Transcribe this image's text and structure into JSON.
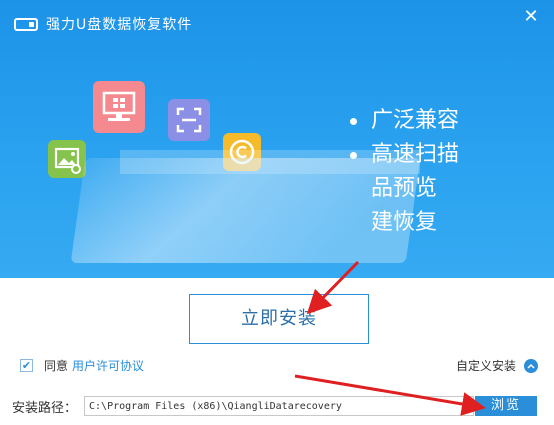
{
  "window": {
    "title": "强力U盘数据恢复软件",
    "close_glyph": "✕"
  },
  "hero": {
    "features": [
      "广泛兼容",
      "高速扫描",
      "品预览",
      "建恢复"
    ]
  },
  "actions": {
    "install_label": "立即安装",
    "browse_label": "浏览"
  },
  "agreement": {
    "checked": true,
    "check_glyph": "✔",
    "prefix": "同意",
    "link_text": "用户许可协议"
  },
  "custom_install": {
    "label": "自定义安装",
    "icon": "chevron-up-icon"
  },
  "install_path": {
    "label": "安装路径：",
    "value": "C:\\Program Files (x86)\\QiangliDatarecovery"
  },
  "colors": {
    "hero_blue": "#2aa2ef",
    "accent": "#2a8ed8",
    "arrow_red": "#e02020"
  },
  "icons": [
    "usb-drive-icon",
    "monitor-icon",
    "scan-icon",
    "image-icon",
    "copyright-icon"
  ]
}
